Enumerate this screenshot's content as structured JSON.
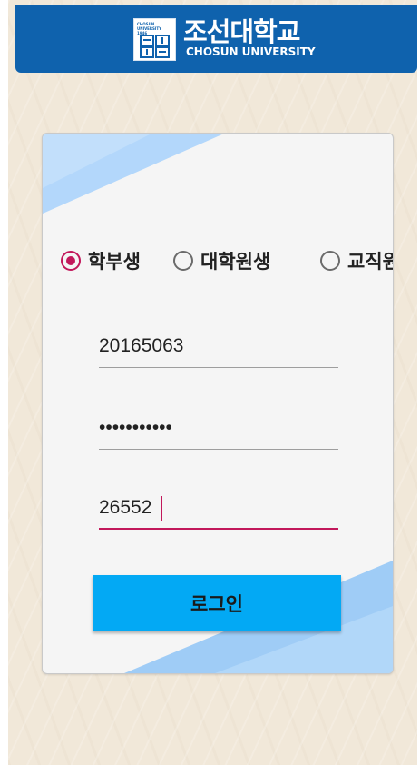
{
  "header": {
    "title_kr": "조선대학교",
    "title_en": "CHOSUN UNIVERSITY",
    "seal_text": "CHOSUN UNIVERSITY 1946",
    "bg_color": "#0f62ad"
  },
  "login": {
    "user_types": [
      {
        "label": "학부생",
        "selected": true
      },
      {
        "label": "대학원생",
        "selected": false
      },
      {
        "label": "교직원",
        "selected": false
      }
    ],
    "student_id": "20165063",
    "password": "12345678901",
    "third_field": "26552",
    "button_label": "로그인",
    "accent_color": "#c2185b",
    "button_color": "#03a9f4"
  }
}
